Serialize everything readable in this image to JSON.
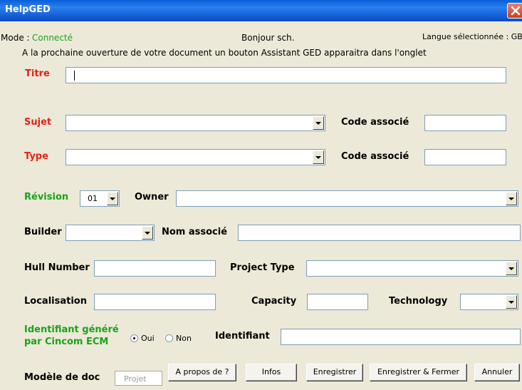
{
  "window": {
    "title": "HelpGED",
    "close_icon": "close-icon"
  },
  "status": {
    "mode_label": "Mode :",
    "mode_value": "Connecté",
    "greeting": "Bonjour sch.",
    "language": "Langue sélectionnée : GB",
    "info": "A la prochaine ouverture de votre document un bouton Assistant GED apparaitra dans l'onglet"
  },
  "form": {
    "titre": {
      "label": "Titre",
      "value": ""
    },
    "sujet": {
      "label": "Sujet",
      "value": "",
      "code_label": "Code associé",
      "code_value": ""
    },
    "type": {
      "label": "Type",
      "value": "",
      "code_label": "Code associé",
      "code_value": ""
    },
    "revision": {
      "label": "Révision",
      "value": "01"
    },
    "owner": {
      "label": "Owner",
      "value": ""
    },
    "builder": {
      "label": "Builder",
      "value": "",
      "nom_label": "Nom associé",
      "nom_value": ""
    },
    "hull": {
      "label": "Hull Number",
      "value": ""
    },
    "project_type": {
      "label": "Project Type",
      "value": ""
    },
    "localisation": {
      "label": "Localisation",
      "value": ""
    },
    "capacity": {
      "label": "Capacity",
      "value": ""
    },
    "technology": {
      "label": "Technology",
      "value": ""
    },
    "identifiant_genere": {
      "label_line1": "Identifiant généré",
      "label_line2": "par Cincom ECM",
      "oui": "Oui",
      "non": "Non",
      "selected": "Oui"
    },
    "identifiant": {
      "label": "Identifiant",
      "value": ""
    },
    "modele": {
      "label": "Modèle de doc",
      "placeholder": "Projet"
    }
  },
  "buttons": {
    "apropos": "A propos de ?",
    "infos": "Infos",
    "enregistrer": "Enregistrer",
    "enregistrer_fermer": "Enregistrer & Fermer",
    "annuler": "Annuler"
  },
  "colors": {
    "required": "#e2231a",
    "green": "#1aa31a",
    "titlebar": "#0a5fd8",
    "background": "#ece9d8"
  }
}
